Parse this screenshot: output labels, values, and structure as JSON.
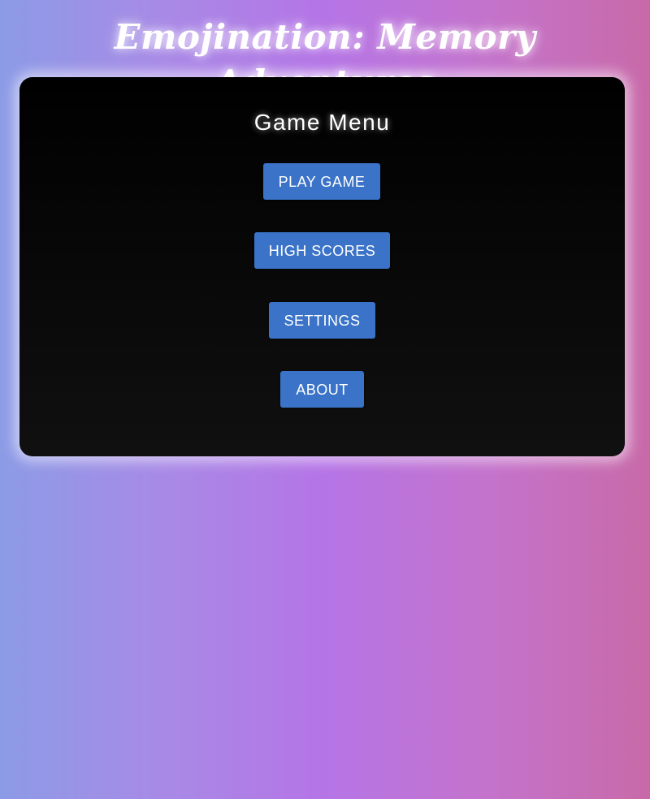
{
  "app": {
    "title": "Emojination: Memory Adventures"
  },
  "menu": {
    "heading": "Game Menu",
    "buttons": [
      {
        "label": "PLAY GAME"
      },
      {
        "label": "HIGH SCORES"
      },
      {
        "label": "SETTINGS"
      },
      {
        "label": "ABOUT"
      }
    ]
  },
  "colors": {
    "button": "#3a73c7",
    "panel": "#000000",
    "background_start": "#8c9be6",
    "background_end": "#c86aa8"
  }
}
